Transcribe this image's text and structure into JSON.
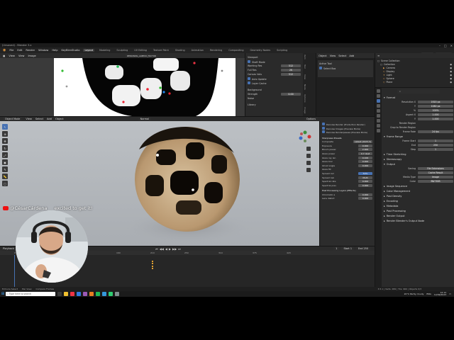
{
  "window": {
    "title": "(Unsaved) - Blender 3.x"
  },
  "menubar": {
    "menus": [
      "File",
      "Edit",
      "Render",
      "Window",
      "Help",
      "KeyBlenStudio"
    ],
    "workspaces": [
      "Layout",
      "Modeling",
      "Sculpting",
      "UV Editing",
      "Texture Paint",
      "Shading",
      "Animation",
      "Rendering",
      "Compositing",
      "Geometry Nodes",
      "Scripting"
    ],
    "active_workspace": "Layout",
    "scene": "Scene",
    "view_layer": "ViewLayer"
  },
  "image_editor": {
    "header": [
      "View",
      "View",
      "Image"
    ],
    "image_name": "DENOISING_ALBEDO_FACTOR"
  },
  "npanel": {
    "rows": [
      {
        "label": "Viewport",
        "value": ""
      },
      {
        "label": "Show Displacement",
        "value": ""
      },
      {
        "label": "Working Res",
        "value": "512"
      },
      {
        "label": "Full Res",
        "value": "2K"
      },
      {
        "label": "Canvas Valu",
        "value": "512"
      }
    ],
    "checks": [
      "Shaft Mode",
      "Auto Update",
      "Layer Cache"
    ],
    "extra": [
      "Background",
      "Strength",
      "Noise",
      "Library"
    ],
    "strength_value": "0.00"
  },
  "vtabs": [
    "Item",
    "Tool",
    "View",
    "Node",
    "Options",
    "Image"
  ],
  "node_panel": {
    "title": "Active Tool",
    "items": [
      "Select Box"
    ]
  },
  "outliner": {
    "title": "Scene Collection",
    "items": [
      "Collection",
      "Camera",
      "Display",
      "Light",
      "Sphere",
      "Plane"
    ]
  },
  "properties": {
    "sections": [
      {
        "title": "Format",
        "rows": [
          [
            "Resolution X",
            "1920 px"
          ],
          [
            "Y",
            "1080 px"
          ],
          [
            "%",
            "100%"
          ],
          [
            "Aspect X",
            "1.000"
          ],
          [
            "Y",
            "1.000"
          ],
          [
            "Render Region",
            ""
          ],
          [
            "Crop to Render Region",
            ""
          ],
          [
            "Frame Rate",
            "24 fps"
          ]
        ]
      },
      {
        "title": "Frame Range",
        "rows": [
          [
            "Frame Start",
            "1"
          ],
          [
            "End",
            "250"
          ],
          [
            "Step",
            "1"
          ]
        ]
      },
      {
        "title": "Time Stretching",
        "rows": []
      },
      {
        "title": "Stereoscopy",
        "rows": []
      },
      {
        "title": "Output",
        "rows": [
          [
            "Saving",
            "File Extensions"
          ],
          [
            "",
            "Cache Result"
          ],
          [
            "Media Type",
            "Image"
          ],
          [
            "Color",
            "BW RGB"
          ]
        ]
      },
      {
        "title": "Image Sequence",
        "rows": []
      },
      {
        "title": "Color Management",
        "rows": []
      },
      {
        "title": "Post Density",
        "rows": []
      },
      {
        "title": "Encoding",
        "rows": []
      },
      {
        "title": "Metadata",
        "rows": []
      },
      {
        "title": "Post Processing",
        "rows": []
      },
      {
        "title": "Render Output",
        "rows": []
      },
      {
        "title": "Render Blender's Output Node",
        "rows": []
      }
    ]
  },
  "viewport": {
    "mode": "Object Mode",
    "menus": [
      "View",
      "Select",
      "Add",
      "Object"
    ],
    "orientation": "Normal",
    "overlay_menu": "Options"
  },
  "rpanel": {
    "checks": [
      "Denoise Render (Production Render)",
      "Denoise Images (Preview Mode)",
      "Denoise Renderpasses (Preview Mode)"
    ],
    "section": "Sharpness Presets",
    "mode_label": "Composite",
    "mode_value": "Latest (2023.3)",
    "rows": [
      [
        "Exposure",
        "0.000"
      ],
      [
        "Bloom power",
        "2.000"
      ],
      [
        "Glare power",
        "0.7 dust"
      ],
      [
        "Glare ray len",
        "0.100"
      ],
      [
        "Glare blur",
        "0.000"
      ],
      [
        "Ghost angle",
        "0.000"
      ],
      [
        "Glare fill",
        ""
      ],
      [
        "Spread rad",
        "50%"
      ],
      [
        "Spread rain",
        "Multi"
      ],
      [
        "Spectral rate",
        "0.000"
      ],
      [
        "Spectral prev",
        "0.000"
      ]
    ],
    "post_title": "Post Processing Layers (Effects)",
    "post_rows": [
      [
        "Chromatic a",
        "0.000"
      ],
      [
        "Lens distort",
        "0.000"
      ]
    ]
  },
  "timeline": {
    "menus": [
      "Playback",
      "Keying",
      "View",
      "Marker"
    ],
    "current_frame": "1",
    "start": "1",
    "end": "250",
    "ruler": [
      "0",
      "75",
      "120",
      "160",
      "210",
      "250",
      "310",
      "375",
      "420"
    ]
  },
  "overlay": {
    "channel": "@CésarCárdena",
    "message": "excited to get it!"
  },
  "status": [
    "Extruire Select",
    "Pan View",
    "Compare Frames"
  ],
  "status_right": "3.5.1 | Verts: 482 | Tris: 960 | Objects 0/3",
  "taskbar": {
    "search": "Type here to search",
    "weather": "20°C  Partly cloudy",
    "time": "12:12",
    "date": "12/09/2023",
    "lang": "ENG"
  },
  "colors": {
    "accent": "#4772b3",
    "render_white": "#ffffff",
    "gold": "#c8a878"
  }
}
